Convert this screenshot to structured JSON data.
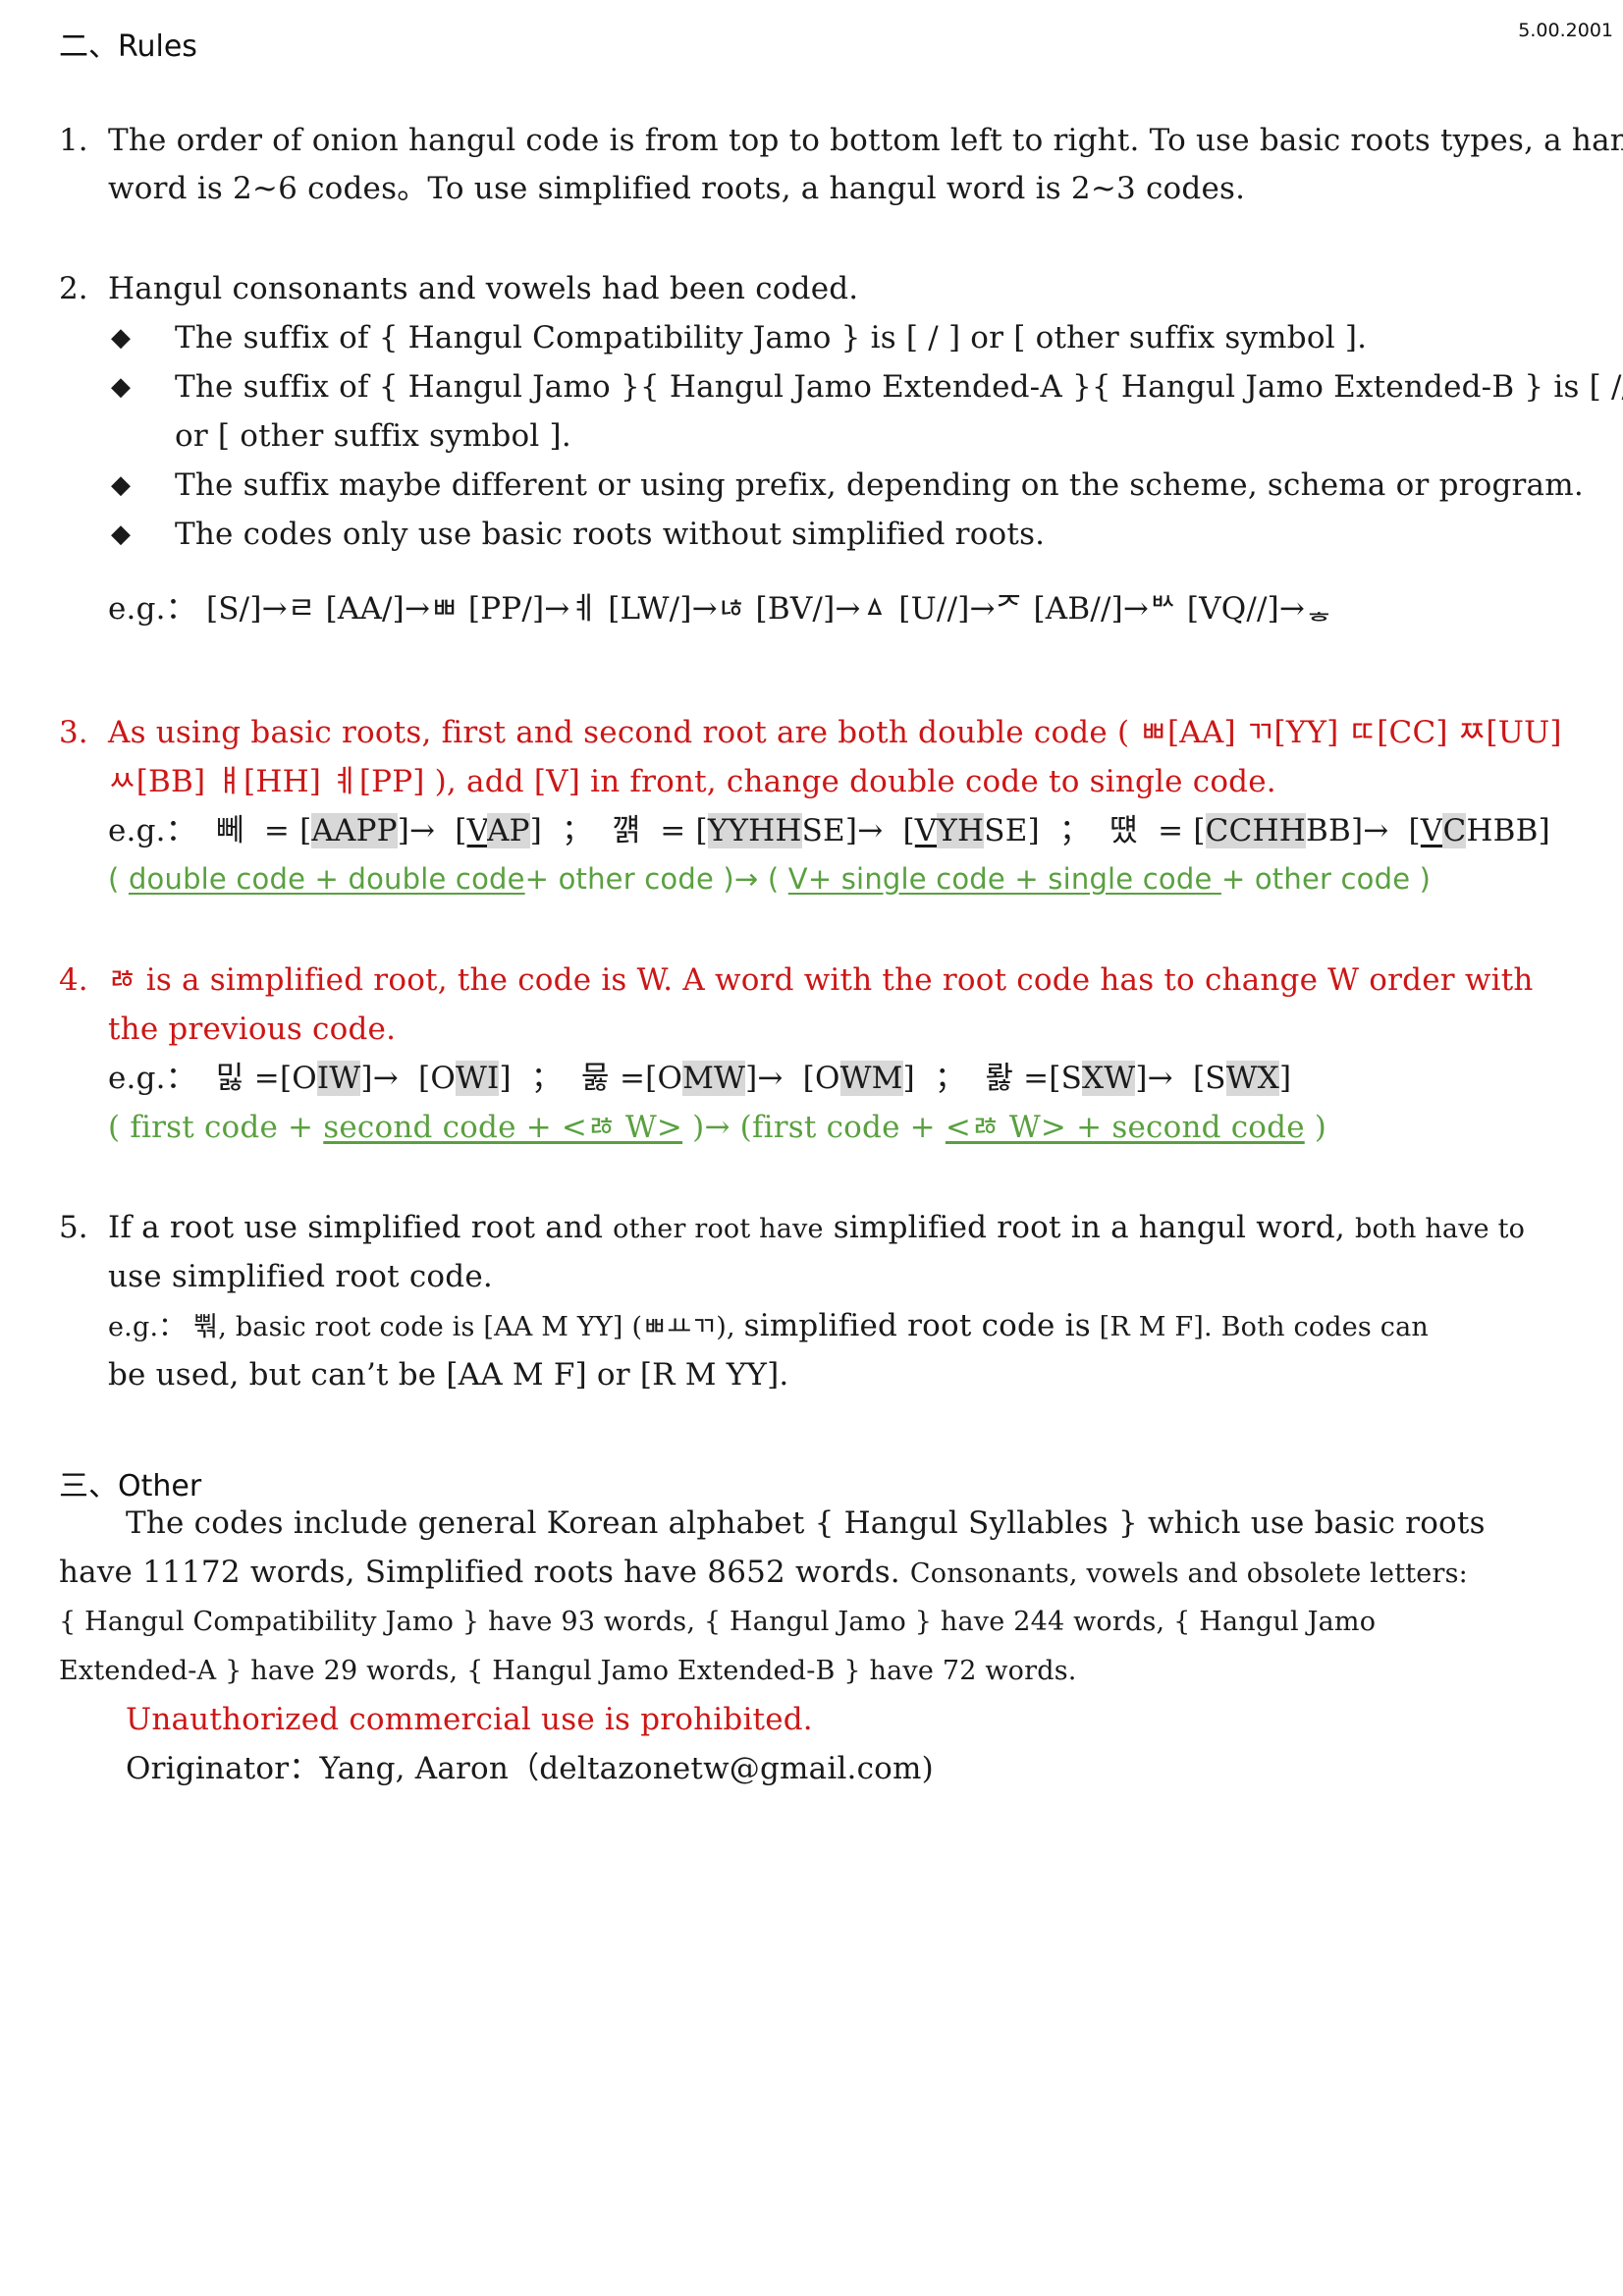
{
  "header": {
    "section2_title": "二、Rules",
    "version": "5.00.2001"
  },
  "rule1": {
    "num": "1.",
    "line1": "The order of onion hangul code is from top to bottom left to right. To use basic roots types, a hangul",
    "line2": "word is 2~6 codes。To use simplified roots, a hangul word is 2~3 codes."
  },
  "rule2": {
    "num": "2.",
    "intro": "Hangul consonants and vowels had been coded.",
    "bullet_symbol": "◆",
    "bullets": [
      "The suffix of { Hangul Compatibility Jamo } is [ / ] or [ other suffix symbol ].",
      "The suffix of { Hangul Jamo }{ Hangul Jamo Extended-A }{ Hangul Jamo Extended-B } is [ // ]",
      "or [ other suffix symbol ].",
      "The suffix maybe different or using prefix, depending on the scheme, schema or program.",
      "The codes only use basic roots without simplified roots."
    ],
    "example": "e.g.：  [S/]→ㄹ  [AA/]→ㅃ  [PP/]→ㅖ  [LW/]→ㄶ  [BV/]→ㅿ  [U//]→ᅎ  [AB//]→ᄡ  [VQ//]→ᇂ"
  },
  "rule3": {
    "num": "3.",
    "line1": "As using basic roots, first and second root are both double code ( ㅃ[AA]  ㄲ[YY]  ㄸ[CC]  ㅉ[UU]",
    "line2": "ㅆ[BB]  ㅒ[HH]  ㅖ[PP] ), add [V] in front, change double code to single code.",
    "eg_label": "e.g.：",
    "ex1_char": "뻬",
    "ex1_eq": "= [",
    "ex1_before": "AAPP",
    "ex1_after_pre": "V",
    "ex1_after_hl": "AP",
    "ex2_char": "꺩",
    "ex2_before_hl": "YYHH",
    "ex2_before_rest": "SE",
    "ex2_after_pre": "V",
    "ex2_after_hl": "YH",
    "ex2_after_rest": "SE",
    "ex3_char": "떘",
    "ex3_before_hl": "CCHH",
    "ex3_before_rest": "BB",
    "ex3_after_pre": "V",
    "ex3_after_hl": "C",
    "ex3_after_rest": "HBB",
    "sep": "；",
    "arrow": "→",
    "formula_open": "( ",
    "formula_a": "double code + double code",
    "formula_b": "+ other code )→  ( ",
    "formula_c": "V+ single code + single code ",
    "formula_d": "+ other code )"
  },
  "rule4": {
    "num": "4.",
    "line1": "ㅀ is a simplified root, the code is W. A word with the root code has to change W order with",
    "line2": "the previous code.",
    "eg_label": "e.g.：",
    "ex1_char": "밇",
    "ex1_a_pre": "O",
    "ex1_a_hl": "IW",
    "ex1_b_pre": "O",
    "ex1_b_hl": "WI",
    "ex2_char": "뭃",
    "ex2_a_pre": "O",
    "ex2_a_hl": "MW",
    "ex2_b_pre": "O",
    "ex2_b_hl": "WM",
    "ex3_char": "뢇",
    "ex3_a_pre": "S",
    "ex3_a_hl": "XW",
    "ex3_b_pre": "S",
    "ex3_b_hl": "WX",
    "formula_open": "( first code + ",
    "formula_a": "second code + <ㅀ W>",
    "formula_b": " )→  (first code + ",
    "formula_c": "<ㅀ W> + second code",
    "formula_d": " )"
  },
  "rule5": {
    "num": "5.",
    "line1_a": "If a root use simplified root and ",
    "line1_b": "other root have",
    "line1_c": " simplified root in a hangul word, ",
    "line1_d": "both have to",
    "line2": "use simplified root code.",
    "ex_line1_a": "e.g.：  뿪, basic root code is [AA M YY] (ㅃㅛㄲ), ",
    "ex_line1_b": "simplified root code is",
    "ex_line1_c": " [R M F]. Both codes can",
    "ex_line2": "be used, but can’t be [AA M F] or [R M YY]."
  },
  "other": {
    "section3_title": "三、Other",
    "p1_line1": "The codes include general Korean alphabet { Hangul Syllables } which use basic roots",
    "p1_line2_a": "have 11172 words, Simplified roots have 8652 words. ",
    "p1_line2_b": "Consonants, vowels and obsolete letters:",
    "p1_line3": "{ Hangul Compatibility Jamo } have 93 words, { Hangul Jamo } have 244 words, { Hangul Jamo",
    "p1_line4": "Extended-A } have 29 words, { Hangul Jamo Extended-B } have 72 words.",
    "warning": "Unauthorized commercial use is prohibited.",
    "originator": "Originator：Yang, Aaron（deltazonetw@gmail.com)"
  }
}
